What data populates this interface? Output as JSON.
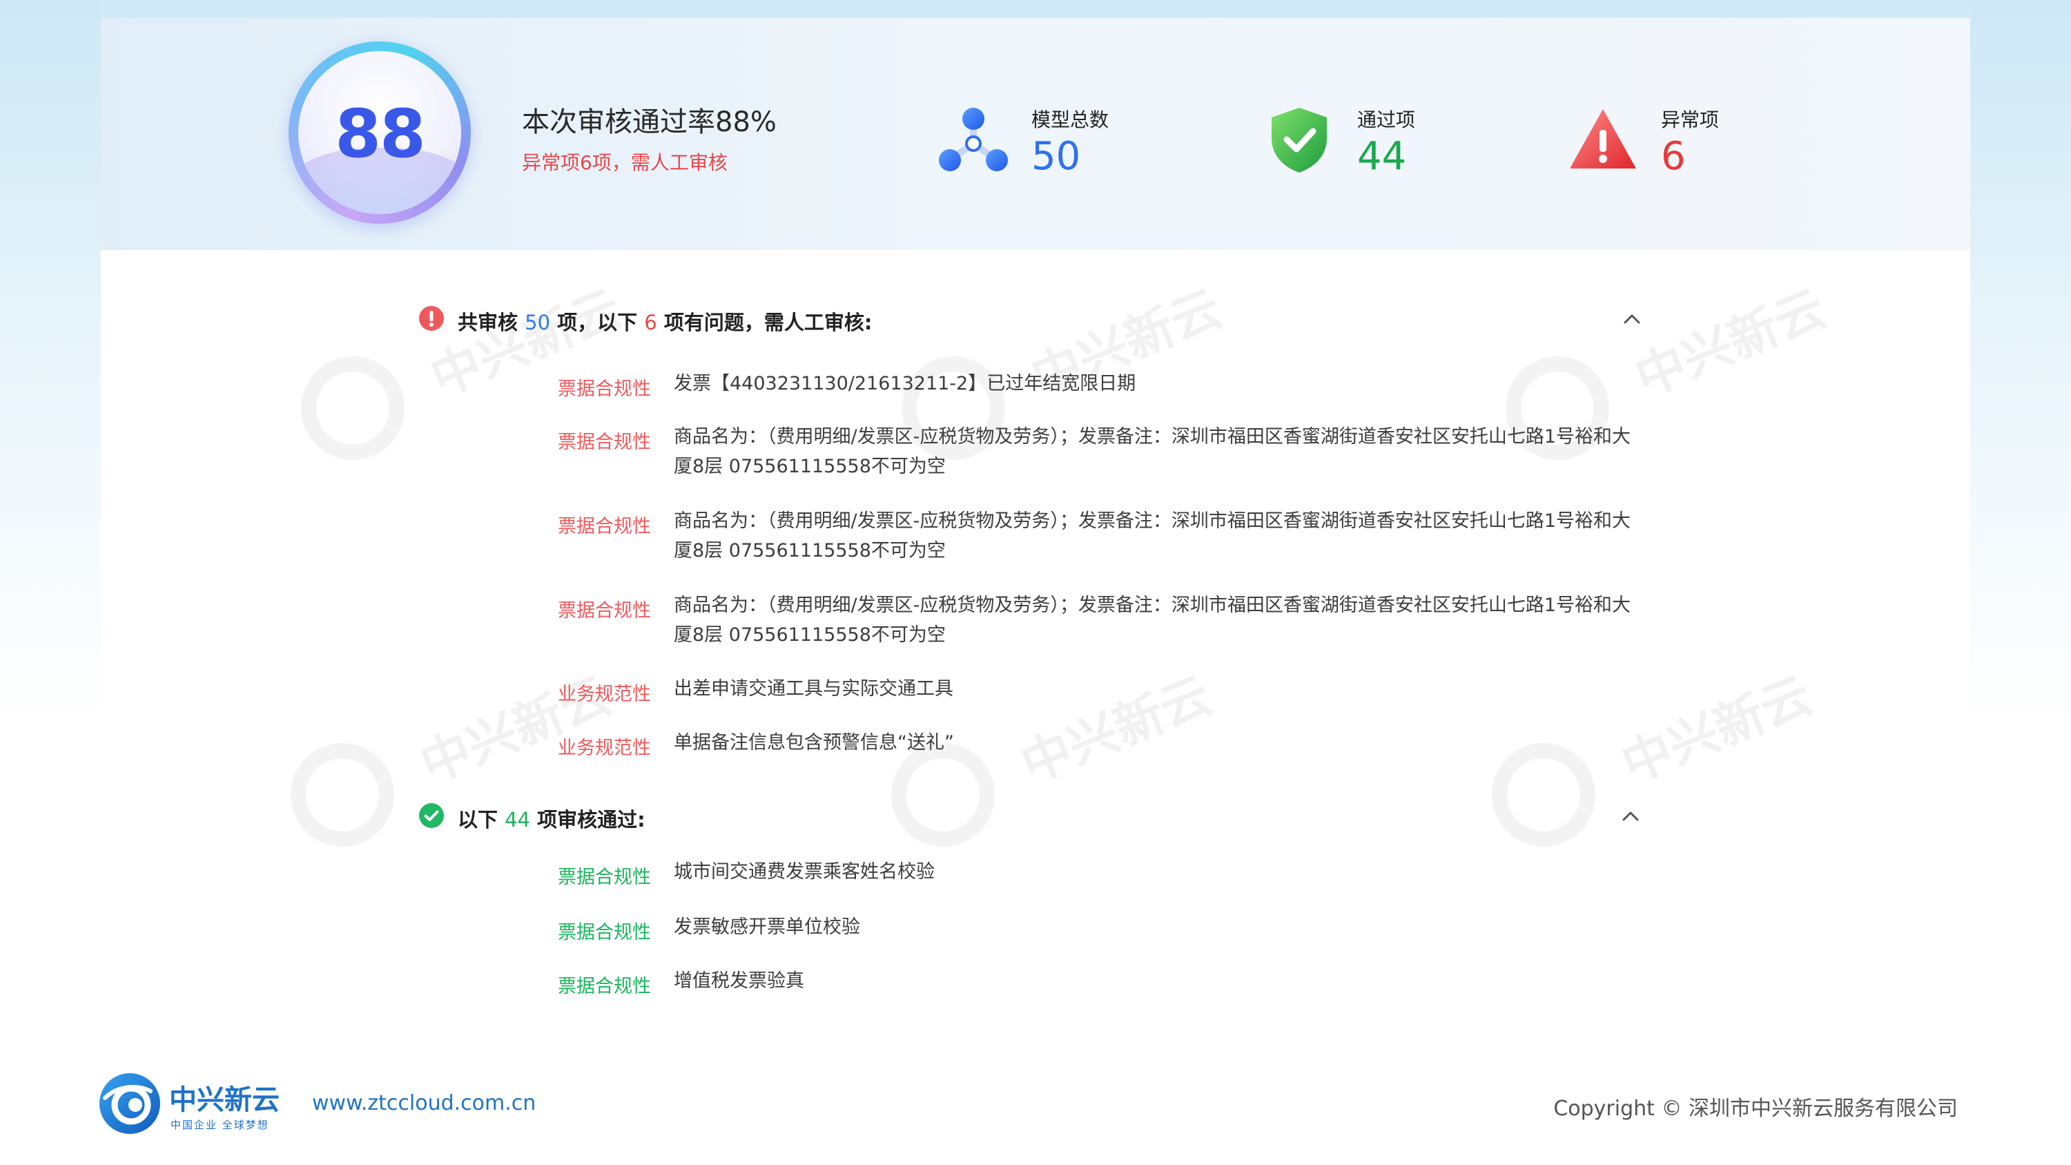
{
  "summary": {
    "score": "88",
    "pass_rate_title": "本次审核通过率88%",
    "pass_rate_subtitle": "异常项6项，需人工审核"
  },
  "stats": [
    {
      "label": "模型总数",
      "value": "50",
      "color": "#2f6ff0",
      "icon": "model-network-icon"
    },
    {
      "label": "通过项",
      "value": "44",
      "color": "#1aa84c",
      "icon": "shield-check-icon"
    },
    {
      "label": "异常项",
      "value": "6",
      "color": "#e8383a",
      "icon": "warning-triangle-icon"
    }
  ],
  "issues_section": {
    "prefix": "共审核",
    "total": "50",
    "middle": "项，以下",
    "count": "6",
    "suffix": "项有问题，需人工审核:",
    "items": [
      {
        "tag": "票据合规性",
        "text": "发票【4403231130/21613211-2】已过年结宽限日期"
      },
      {
        "tag": "票据合规性",
        "text": "商品名为：（费用明细/发票区-应税货物及劳务）；发票备注：深圳市福田区香蜜湖街道香安社区安托山七路1号裕和大厦8层 075561115558不可为空"
      },
      {
        "tag": "票据合规性",
        "text": "商品名为：（费用明细/发票区-应税货物及劳务）；发票备注：深圳市福田区香蜜湖街道香安社区安托山七路1号裕和大厦8层 075561115558不可为空"
      },
      {
        "tag": "票据合规性",
        "text": "商品名为：（费用明细/发票区-应税货物及劳务）；发票备注：深圳市福田区香蜜湖街道香安社区安托山七路1号裕和大厦8层 075561115558不可为空"
      },
      {
        "tag": "业务规范性",
        "text": "出差申请交通工具与实际交通工具"
      },
      {
        "tag": "业务规范性",
        "text": "单据备注信息包含预警信息“送礼”"
      }
    ]
  },
  "passed_section": {
    "prefix": "以下",
    "count": "44",
    "suffix": "项审核通过:",
    "items": [
      {
        "tag": "票据合规性",
        "text": "城市间交通费发票乘客姓名校验"
      },
      {
        "tag": "票据合规性",
        "text": "发票敏感开票单位校验"
      },
      {
        "tag": "票据合规性",
        "text": "增值税发票验真"
      }
    ]
  },
  "watermark": {
    "brand": "中兴新云",
    "slogan": "中国企业 全球梦想"
  },
  "footer": {
    "brand": "中兴新云",
    "slogan": "中国企业 全球梦想",
    "url": "www.ztccloud.com.cn",
    "copyright": "Copyright © 深圳市中兴新云服务有限公司"
  },
  "colors": {
    "red": "#e8484a",
    "green": "#1bb55c",
    "blue": "#2f7df0"
  }
}
